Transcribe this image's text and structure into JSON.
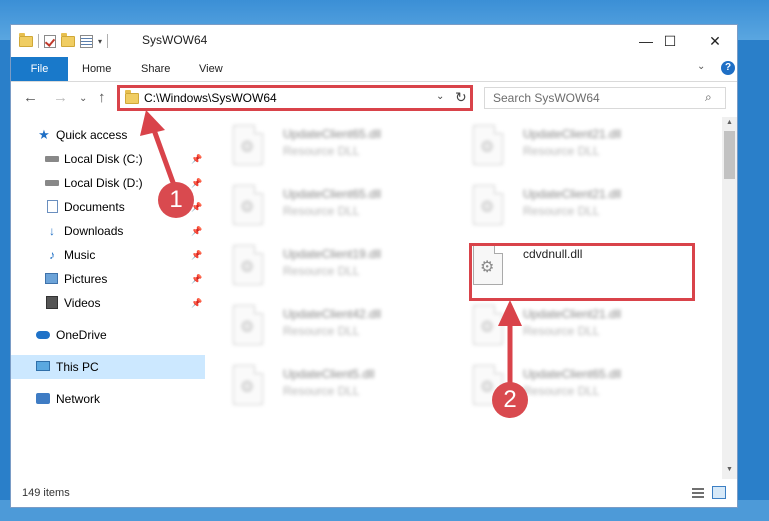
{
  "window": {
    "title": "SysWOW64",
    "controls": {
      "minimize": "—",
      "maximize": "☐",
      "close": "✕"
    }
  },
  "ribbon": {
    "tabs": [
      "File",
      "Home",
      "Share",
      "View"
    ],
    "collapse_icon": "chevron-down",
    "help": "?"
  },
  "navigation": {
    "back": "←",
    "forward": "→",
    "up": "↑"
  },
  "address": {
    "path": "C:\\Windows\\SysWOW64",
    "dropdown": "⌄",
    "refresh": "↻"
  },
  "search": {
    "placeholder": "Search SysWOW64",
    "icon": "⌕"
  },
  "sidebar": {
    "items": [
      {
        "label": "Quick access",
        "icon": "star-icon"
      },
      {
        "label": "Local Disk (C:)",
        "icon": "drive-icon",
        "pinned": true
      },
      {
        "label": "Local Disk (D:)",
        "icon": "drive-icon",
        "pinned": true
      },
      {
        "label": "Documents",
        "icon": "documents-icon",
        "pinned": true
      },
      {
        "label": "Downloads",
        "icon": "download-icon",
        "pinned": true
      },
      {
        "label": "Music",
        "icon": "music-icon",
        "pinned": true
      },
      {
        "label": "Pictures",
        "icon": "pictures-icon",
        "pinned": true
      },
      {
        "label": "Videos",
        "icon": "videos-icon",
        "pinned": true
      },
      {
        "label": "OneDrive",
        "icon": "onedrive-icon"
      },
      {
        "label": "This PC",
        "icon": "computer-icon",
        "selected": true
      },
      {
        "label": "Network",
        "icon": "network-icon"
      }
    ]
  },
  "files": [
    {
      "name": "UpdateClient65.dll",
      "type": "Resource DLL",
      "blurred": true
    },
    {
      "name": "UpdateClient21.dll",
      "type": "Resource DLL",
      "blurred": true
    },
    {
      "name": "UpdateClient65.dll",
      "type": "Resource DLL",
      "blurred": true
    },
    {
      "name": "UpdateClient21.dll",
      "type": "Resource DLL",
      "blurred": true
    },
    {
      "name": "UpdateClient19.dll",
      "type": "Resource DLL",
      "blurred": true
    },
    {
      "name": "cdvdnull.dll",
      "type": "",
      "blurred": false,
      "highlighted": true
    },
    {
      "name": "UpdateClient42.dll",
      "type": "Resource DLL",
      "blurred": true
    },
    {
      "name": "UpdateClient21.dll",
      "type": "Resource DLL",
      "blurred": true
    },
    {
      "name": "UpdateClient5.dll",
      "type": "Resource DLL",
      "blurred": true
    },
    {
      "name": "UpdateClient65.dll",
      "type": "Resource DLL",
      "blurred": true
    }
  ],
  "status": {
    "item_count": "149 items"
  },
  "annotations": {
    "step1": "1",
    "step2": "2",
    "highlight_color": "#d9434a"
  },
  "colors": {
    "file_tab": "#1979ca",
    "selection": "#cce8ff",
    "desktop": "#2a7fc9"
  }
}
